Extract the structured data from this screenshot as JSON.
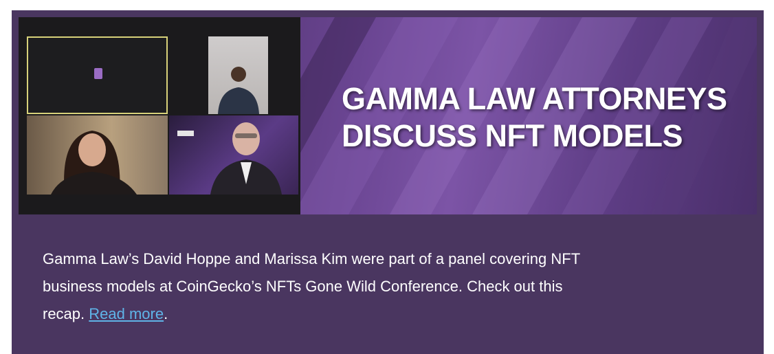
{
  "banner": {
    "title_line1": "GAMMA LAW ATTORNEYS",
    "title_line2": "DISCUSS NFT MODELS"
  },
  "article": {
    "text_line1": "Gamma Law’s David Hoppe and Marissa Kim were part of a panel covering NFT",
    "text_line2": "business models at CoinGecko’s NFTs Gone Wild Conference. Check out this",
    "text_prefix": "recap. ",
    "link_label": "Read more",
    "text_suffix": "."
  },
  "colors": {
    "card_bg": "#4a3660",
    "link": "#5fb4e8",
    "title_text": "#ffffff"
  }
}
